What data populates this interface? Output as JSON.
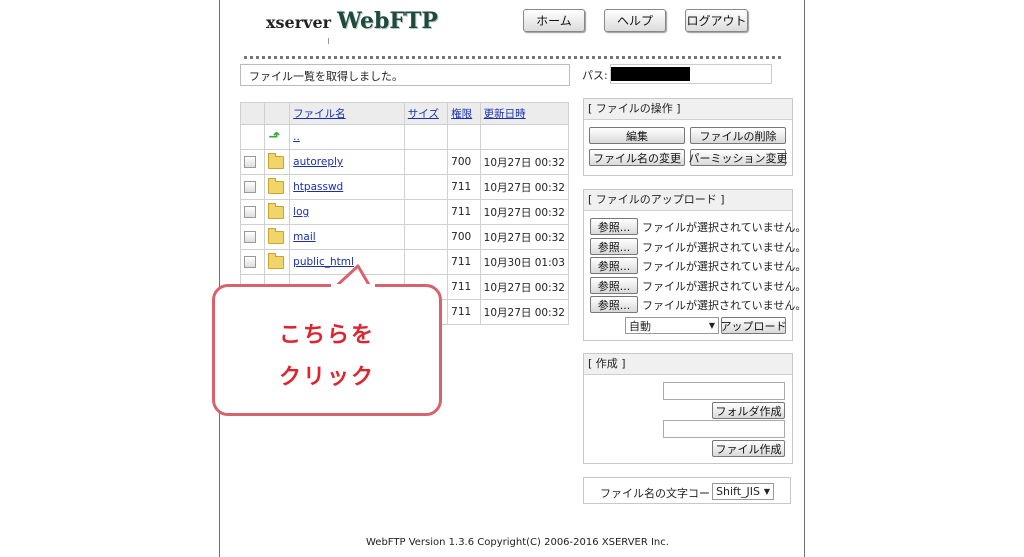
{
  "logo": {
    "brand": "xserver",
    "product": "WebFTP"
  },
  "header_buttons": [
    "ホーム",
    "ヘルプ",
    "ログアウト"
  ],
  "status_message": "ファイル一覧を取得しました。",
  "path": {
    "label": "パス:"
  },
  "table": {
    "headers": [
      "ファイル名",
      "サイズ",
      "権限",
      "更新日時"
    ],
    "parent": "..",
    "rows": [
      {
        "name": "autoreply",
        "perm": "700",
        "date": "10月27日 00:32"
      },
      {
        "name": "htpasswd",
        "perm": "711",
        "date": "10月27日 00:32"
      },
      {
        "name": "log",
        "perm": "711",
        "date": "10月27日 00:32"
      },
      {
        "name": "mail",
        "perm": "700",
        "date": "10月27日 00:32"
      },
      {
        "name": "public_html",
        "perm": "711",
        "date": "10月30日 01:03"
      },
      {
        "name": "",
        "perm": "711",
        "date": "10月27日 00:32"
      },
      {
        "name": "",
        "perm": "711",
        "date": "10月27日 00:32"
      }
    ]
  },
  "file_ops": {
    "title": "[ ファイルの操作 ]",
    "buttons": [
      "編集",
      "ファイルの削除",
      "ファイル名の変更",
      "パーミッション変更"
    ]
  },
  "upload": {
    "title": "[ ファイルのアップロード ]",
    "browse_label": "参照...",
    "no_file_text": "ファイルが選択されていません。",
    "mode_value": "自動",
    "upload_button": "アップロード"
  },
  "create": {
    "title": "[ 作成 ]",
    "folder_button": "フォルダ作成",
    "file_button": "ファイル作成"
  },
  "encoding": {
    "label": "ファイル名の文字コード:",
    "value": "Shift_JIS"
  },
  "footer": "WebFTP Version 1.3.6    Copyright(C) 2006-2016 XSERVER Inc.",
  "callout": {
    "line1": "こちらを",
    "line2": "クリック"
  }
}
